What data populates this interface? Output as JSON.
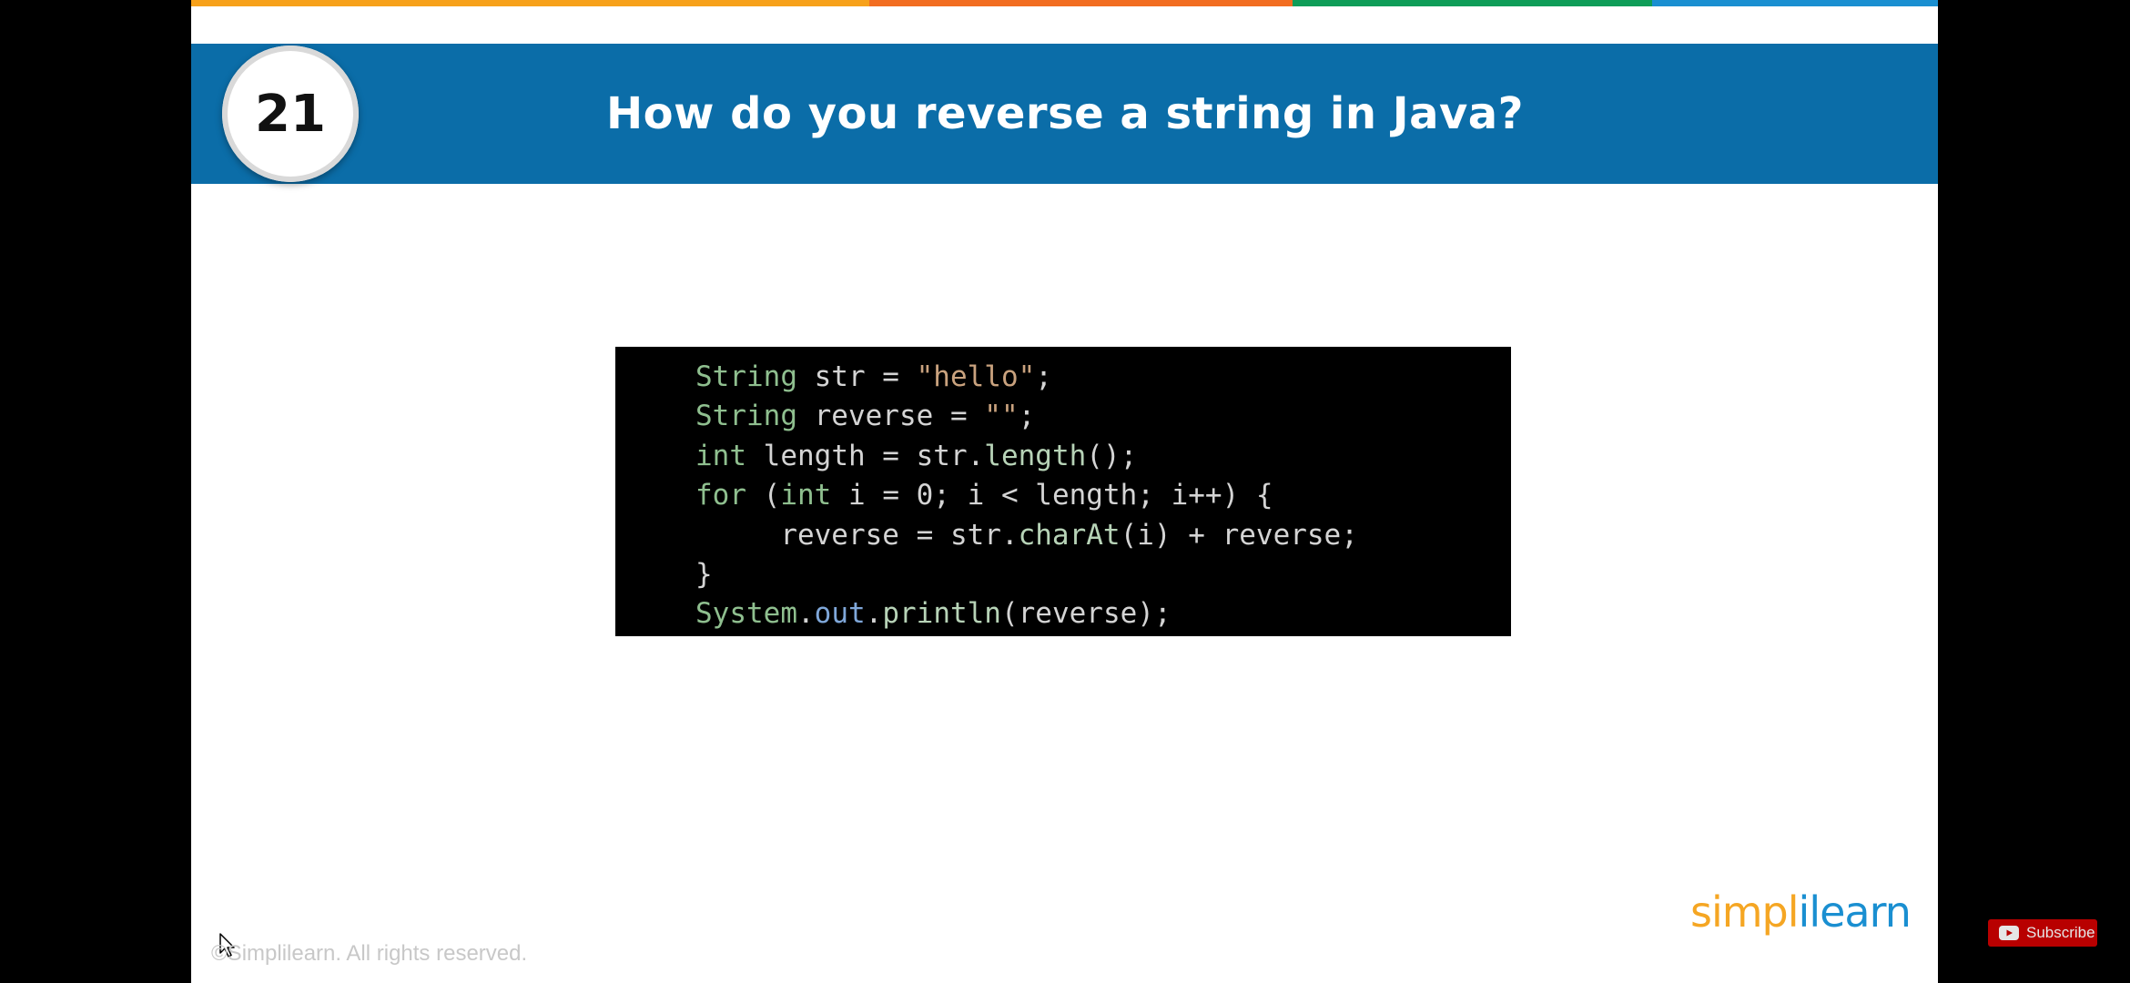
{
  "colors": {
    "background": "#000000",
    "slide_background": "#ffffff",
    "header_blue": "#0b6da8",
    "stripe": [
      "#f7a11a",
      "#f26d21",
      "#0f9d58",
      "#1a8fd1"
    ],
    "code_keyword": "#8fbf8f",
    "code_string": "#c9a27e",
    "code_member": "#7fa7d9",
    "code_plain": "#d4d4d4",
    "code_method": "#b7d3b7"
  },
  "slide": {
    "number": "21",
    "title": "How do you reverse a string in Java?"
  },
  "code": {
    "lines": [
      [
        {
          "text": "String",
          "kind": "keyword"
        },
        {
          "text": " str = ",
          "kind": "plain"
        },
        {
          "text": "\"hello\"",
          "kind": "string"
        },
        {
          "text": ";",
          "kind": "plain"
        }
      ],
      [
        {
          "text": "String",
          "kind": "keyword"
        },
        {
          "text": " reverse = ",
          "kind": "plain"
        },
        {
          "text": "\"\"",
          "kind": "string"
        },
        {
          "text": ";",
          "kind": "plain"
        }
      ],
      [
        {
          "text": "int",
          "kind": "keyword"
        },
        {
          "text": " length = str.",
          "kind": "plain"
        },
        {
          "text": "length",
          "kind": "method"
        },
        {
          "text": "();",
          "kind": "plain"
        }
      ],
      [
        {
          "text": "for",
          "kind": "keyword"
        },
        {
          "text": " (",
          "kind": "plain"
        },
        {
          "text": "int",
          "kind": "keyword"
        },
        {
          "text": " i = 0; i < length; i++) {",
          "kind": "plain"
        }
      ],
      [
        {
          "text": "     reverse = str.",
          "kind": "plain"
        },
        {
          "text": "charAt",
          "kind": "method"
        },
        {
          "text": "(i) + reverse;",
          "kind": "plain"
        }
      ],
      [
        {
          "text": "}",
          "kind": "plain"
        }
      ],
      [
        {
          "text": "System",
          "kind": "keyword"
        },
        {
          "text": ".",
          "kind": "plain"
        },
        {
          "text": "out",
          "kind": "member"
        },
        {
          "text": ".",
          "kind": "plain"
        },
        {
          "text": "println",
          "kind": "method"
        },
        {
          "text": "(reverse);",
          "kind": "plain"
        }
      ]
    ]
  },
  "footer": {
    "copyright": "©Simplilearn. All rights reserved."
  },
  "brand": {
    "logo_part_a": "simpl",
    "logo_part_b": "i",
    "logo_part_c": "learn"
  },
  "youtube": {
    "subscribe_label": "Subscribe",
    "subscribe_icon": "youtube-play-icon"
  },
  "cursor": {
    "icon": "mouse-pointer-icon"
  }
}
